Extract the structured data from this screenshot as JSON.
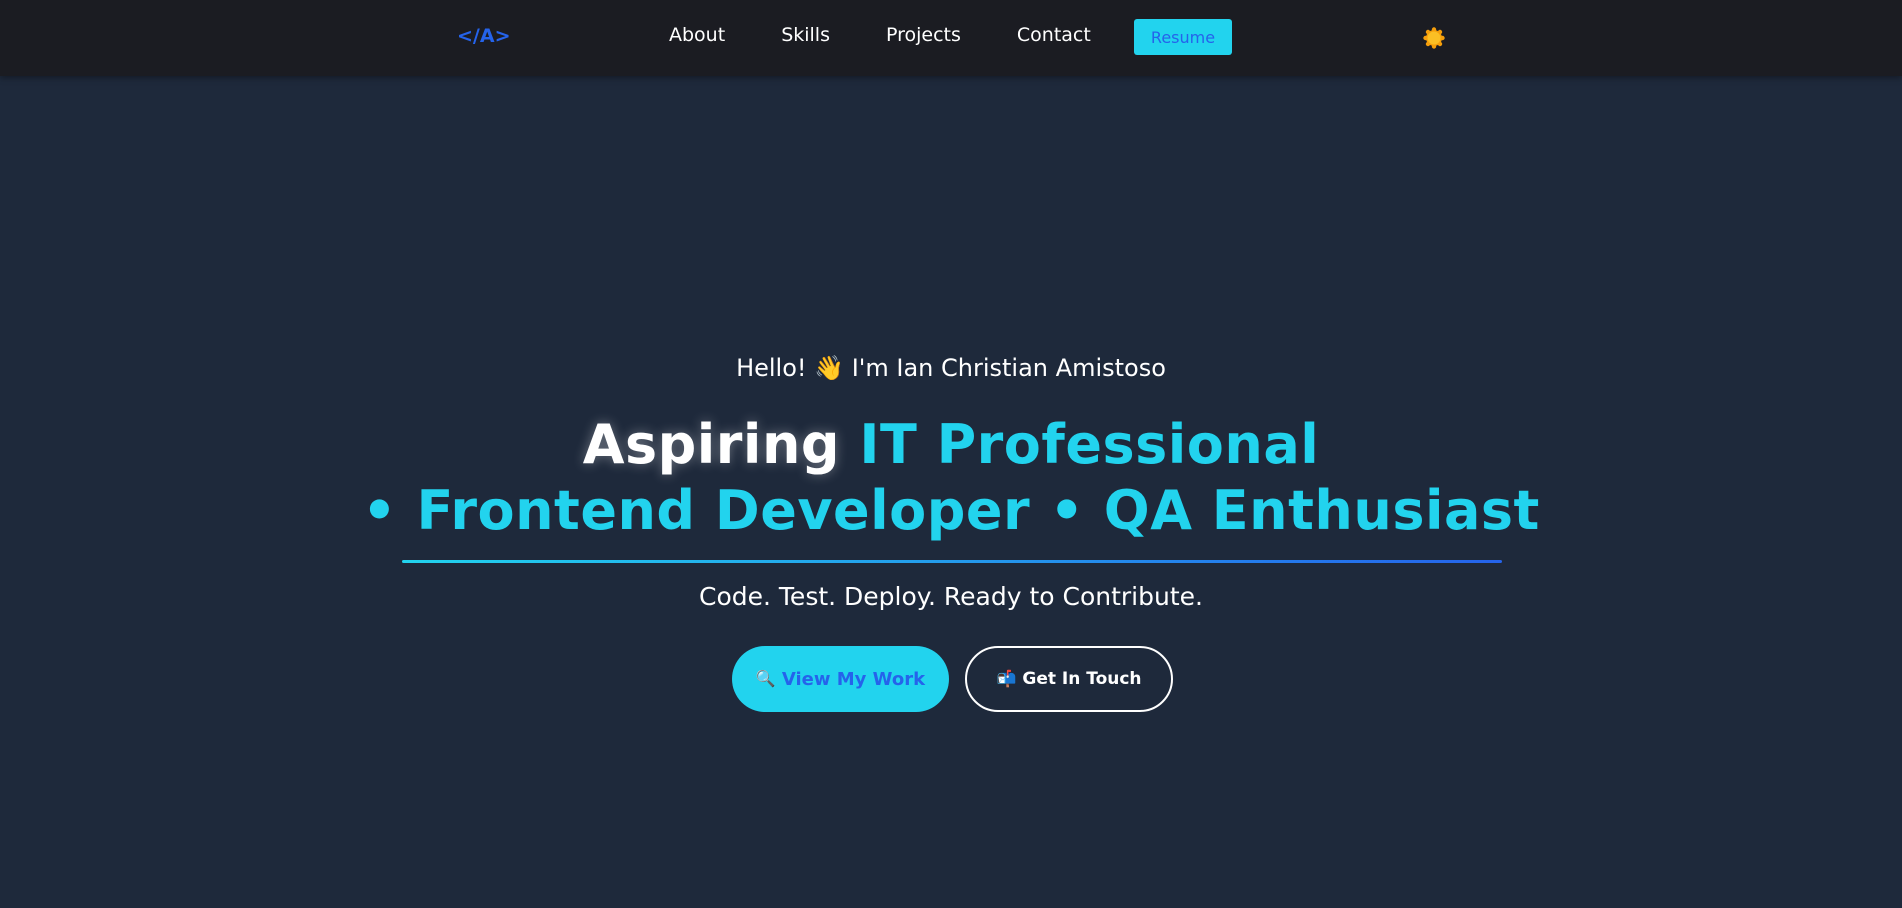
{
  "navbar": {
    "logo": "</A>",
    "links": [
      {
        "label": "About"
      },
      {
        "label": "Skills"
      },
      {
        "label": "Projects"
      },
      {
        "label": "Contact"
      }
    ],
    "resume_label": "Resume",
    "theme_icon": "sun-icon"
  },
  "hero": {
    "greeting_before": "Hello!",
    "greeting_emoji": "👋",
    "greeting_after": "I'm Ian Christian Amistoso",
    "headline_line1_white": "Aspiring",
    "headline_line1_cyan": "IT Professional",
    "headline_line2": "• Frontend Developer • QA Enthusiast",
    "tagline": "Code. Test. Deploy. Ready to Contribute.",
    "primary_cta": {
      "icon": "🔍",
      "label": "View My Work"
    },
    "secondary_cta": {
      "icon": "📬",
      "label": "Get In Touch"
    }
  },
  "colors": {
    "navbar_bg": "#1b1c22",
    "page_bg": "#1e293b",
    "accent_cyan": "#22d3ee",
    "accent_blue": "#2563eb",
    "sun": "#f59e0b"
  }
}
